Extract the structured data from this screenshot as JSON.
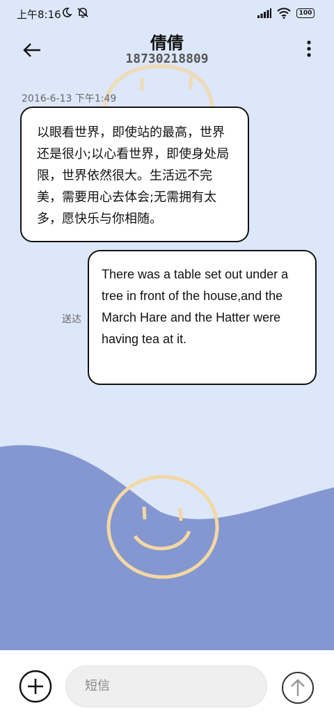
{
  "status_bar": {
    "time": "上午8:16",
    "battery": "100",
    "icons": [
      "moon-icon",
      "mute-icon",
      "signal-icon",
      "wifi-icon",
      "battery-icon"
    ]
  },
  "header": {
    "contact_name": "倩倩",
    "phone_number": "18730218809",
    "icons": [
      "back-arrow-icon",
      "more-vertical-icon"
    ]
  },
  "conversation": {
    "timestamp": "2016-6-13 下午1:49",
    "messages": [
      {
        "direction": "incoming",
        "text": "以眼看世界，即使站的最高，世界还是很小;以心看世界，即使身处局限，世界依然很大。生活远不完美，需要用心去体会;无需拥有太多，愿快乐与你相随。"
      },
      {
        "direction": "outgoing",
        "text": "There was a table set out under a tree in front of the house,and the March Hare and the Hatter were having tea at it.",
        "status": "送达"
      }
    ]
  },
  "composer": {
    "placeholder": "短信",
    "icons": [
      "add-icon",
      "send-arrow-icon"
    ]
  },
  "colors": {
    "background": "#dde7fa",
    "wave": "#8497d1",
    "smiley": "#f3d8a3"
  }
}
